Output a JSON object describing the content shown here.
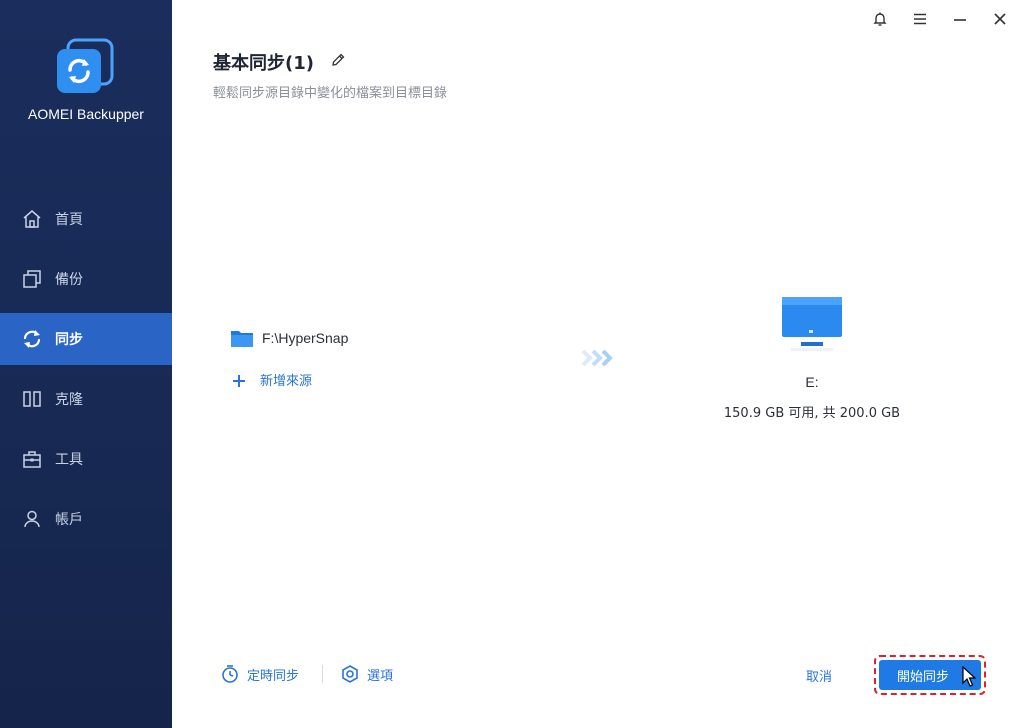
{
  "app": {
    "name": "AOMEI Backupper"
  },
  "sidebar": {
    "items": [
      {
        "label": "首頁",
        "icon": "home-icon",
        "active": false
      },
      {
        "label": "備份",
        "icon": "backup-icon",
        "active": false
      },
      {
        "label": "同步",
        "icon": "sync-icon",
        "active": true
      },
      {
        "label": "克隆",
        "icon": "clone-icon",
        "active": false
      },
      {
        "label": "工具",
        "icon": "tools-icon",
        "active": false
      },
      {
        "label": "帳戶",
        "icon": "account-icon",
        "active": false
      }
    ]
  },
  "titlebar": {
    "icons": [
      "bell-icon",
      "menu-icon",
      "minimize-icon",
      "close-icon"
    ]
  },
  "page": {
    "title": "基本同步(1)",
    "subtitle": "輕鬆同步源目錄中變化的檔案到目標目錄"
  },
  "source": {
    "path": "F:\\HyperSnap",
    "add_label": "新增來源"
  },
  "destination": {
    "drive": "E:",
    "info": "150.9 GB 可用, 共 200.0 GB"
  },
  "footer": {
    "schedule_label": "定時同步",
    "options_label": "選項",
    "cancel_label": "取消",
    "start_label": "開始同步"
  },
  "colors": {
    "sidebar_bg": "#1a2d5c",
    "active_item": "#2a65c6",
    "accent": "#2a74d9",
    "primary_button": "#1f7ae6",
    "highlight_outline": "#e0202a"
  }
}
